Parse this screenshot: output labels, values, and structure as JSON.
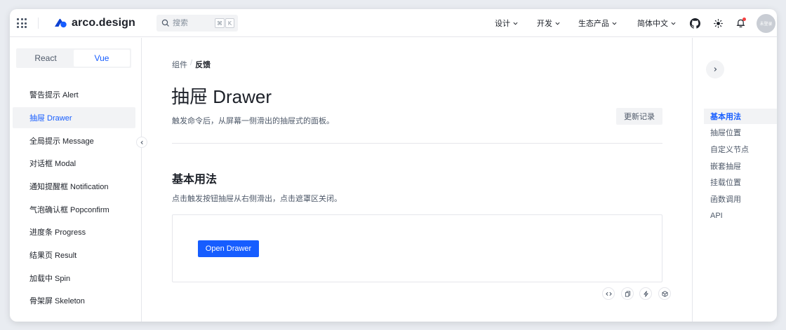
{
  "header": {
    "logo_text": "arco.design",
    "search_placeholder": "搜索",
    "search_kbd_cmd": "⌘",
    "search_kbd_key": "K",
    "menus": [
      "设计",
      "开发",
      "生态产品",
      "简体中文"
    ],
    "avatar_text": "未登录"
  },
  "sidebar": {
    "framework_options": [
      "React",
      "Vue"
    ],
    "active_framework": "Vue",
    "items": [
      {
        "label": "警告提示 Alert"
      },
      {
        "label": "抽屉 Drawer",
        "active": true
      },
      {
        "label": "全局提示 Message"
      },
      {
        "label": "对话框 Modal"
      },
      {
        "label": "通知提醒框 Notification"
      },
      {
        "label": "气泡确认框 Popconfirm"
      },
      {
        "label": "进度条 Progress"
      },
      {
        "label": "结果页 Result"
      },
      {
        "label": "加载中 Spin"
      },
      {
        "label": "骨架屏 Skeleton"
      }
    ]
  },
  "main": {
    "breadcrumb": [
      "组件",
      "反馈"
    ],
    "title": "抽屉 Drawer",
    "description": "触发命令后，从屏幕一侧滑出的抽屉式的面板。",
    "changelog_label": "更新记录",
    "section_title": "基本用法",
    "section_desc": "点击触发按钮抽屉从右侧滑出，点击遮罩区关闭。",
    "demo_button_label": "Open Drawer"
  },
  "toc": {
    "items": [
      {
        "label": "基本用法",
        "active": true
      },
      {
        "label": "抽屉位置"
      },
      {
        "label": "自定义节点"
      },
      {
        "label": "嵌套抽屉"
      },
      {
        "label": "挂载位置"
      },
      {
        "label": "函数调用"
      },
      {
        "label": "API"
      }
    ]
  },
  "colors": {
    "primary": "#165dff",
    "notification_dot": "#f53f3f",
    "text": "#1d2129",
    "text_secondary": "#4e5969",
    "border": "#e5e6eb",
    "fill": "#f2f3f5"
  }
}
